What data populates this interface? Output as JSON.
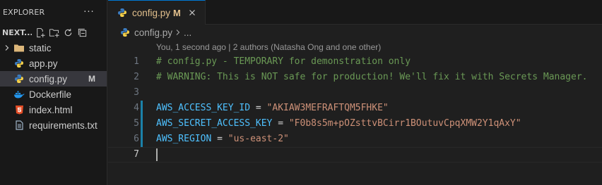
{
  "sidebar": {
    "title": "EXPLORER",
    "more": "···",
    "section_title": "NEXT...",
    "items": [
      {
        "name": "static",
        "type": "folder",
        "badge": ""
      },
      {
        "name": "app.py",
        "type": "python",
        "badge": ""
      },
      {
        "name": "config.py",
        "type": "python",
        "badge": "M",
        "selected": true
      },
      {
        "name": "Dockerfile",
        "type": "docker",
        "badge": ""
      },
      {
        "name": "index.html",
        "type": "html",
        "badge": ""
      },
      {
        "name": "requirements.txt",
        "type": "text",
        "badge": ""
      }
    ]
  },
  "editor": {
    "tab": {
      "label": "config.py",
      "modified": "M"
    },
    "breadcrumb": {
      "file": "config.py",
      "more": "..."
    },
    "codelens": "You, 1 second ago | 2 authors (Natasha Ong and one other)",
    "lines": [
      {
        "num": "1",
        "text": "# config.py - TEMPORARY for demonstration only"
      },
      {
        "num": "2",
        "text": "# WARNING: This is NOT safe for production! We'll fix it with Secrets Manager."
      },
      {
        "num": "3",
        "text": ""
      },
      {
        "num": "4",
        "key": "AWS_ACCESS_KEY_ID",
        "eq": " = ",
        "value": "\"AKIAW3MEFRAFTQM5FHKE\""
      },
      {
        "num": "5",
        "key": "AWS_SECRET_ACCESS_KEY",
        "eq": " = ",
        "value": "\"F0b8s5m+pOZsttvBCirr1BOutuvCpqXMW2Y1qAxY\""
      },
      {
        "num": "6",
        "key": "AWS_REGION",
        "eq": " = ",
        "value": "\"us-east-2\""
      },
      {
        "num": "7",
        "text": ""
      }
    ]
  },
  "colors": {
    "accent": "#0078d4",
    "modified": "#e2c08d",
    "comment": "#6a9955",
    "identifier": "#4fc1ff",
    "string": "#ce9178"
  }
}
